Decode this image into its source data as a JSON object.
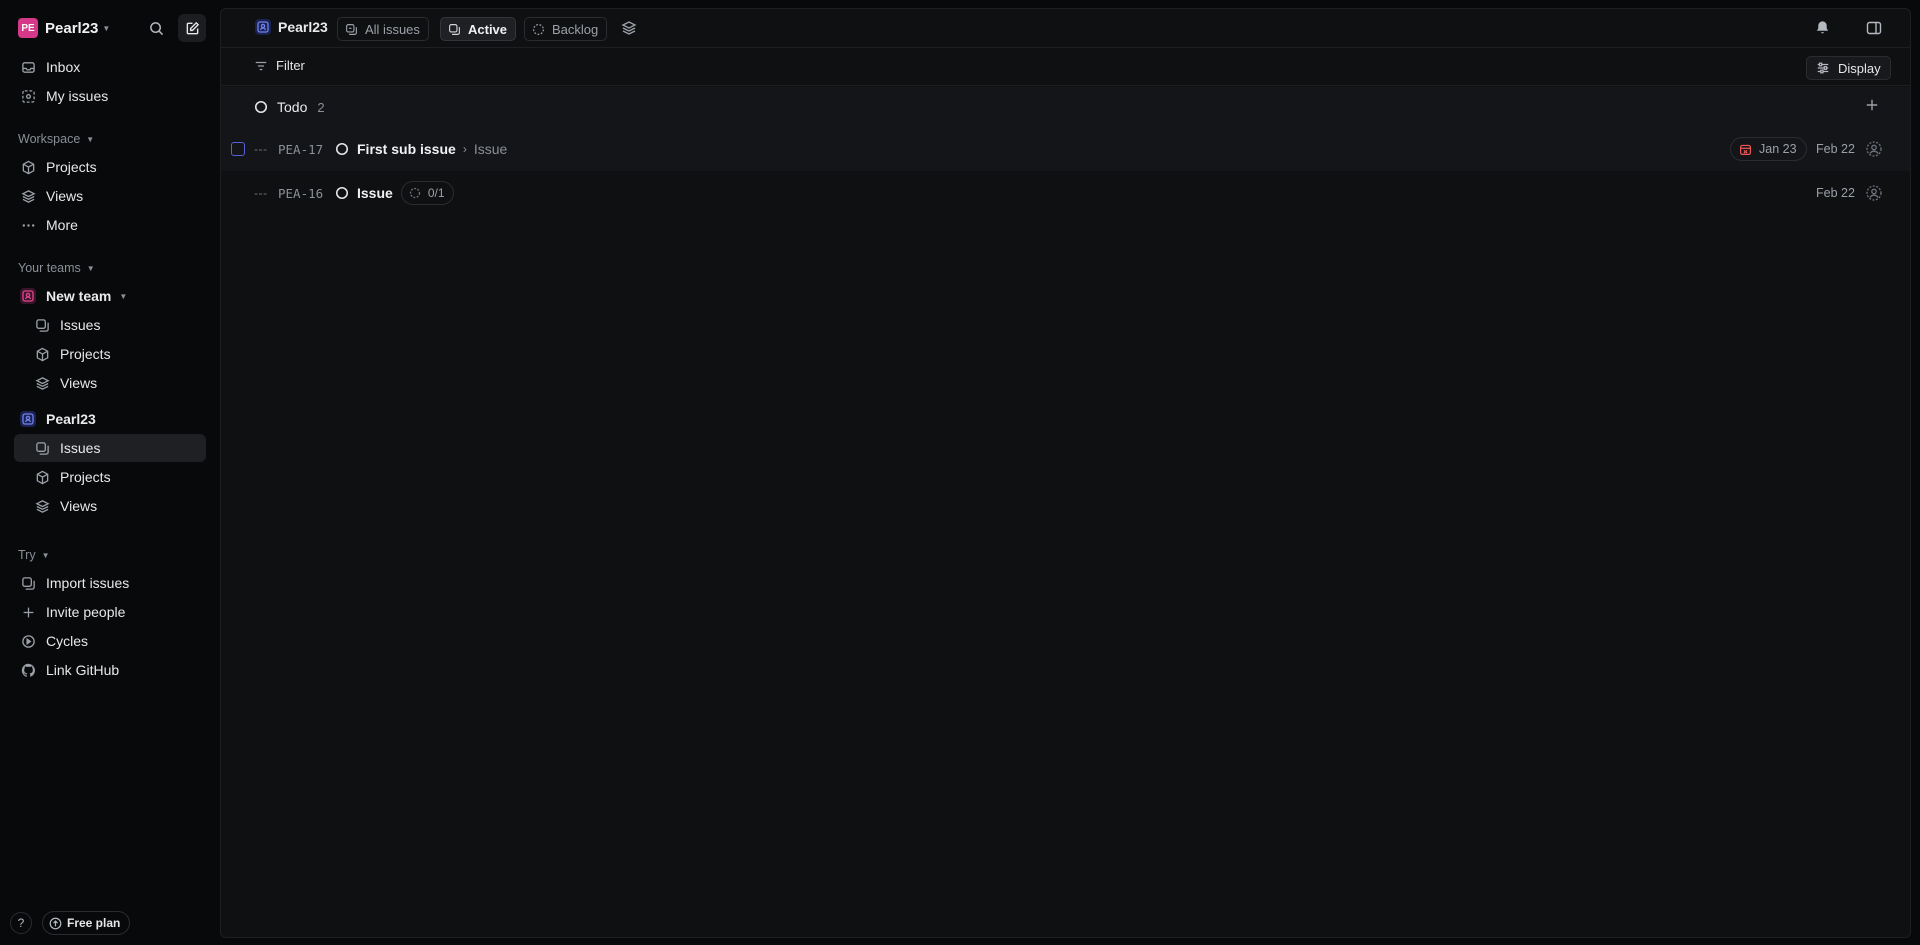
{
  "workspace": {
    "initials": "PE",
    "name": "Pearl23"
  },
  "sidebar": {
    "main": [
      {
        "label": "Inbox",
        "icon": "inbox-icon"
      },
      {
        "label": "My issues",
        "icon": "my-issues-icon"
      }
    ],
    "workspace_label": "Workspace",
    "workspace_items": [
      {
        "label": "Projects",
        "icon": "projects-icon"
      },
      {
        "label": "Views",
        "icon": "views-icon"
      },
      {
        "label": "More",
        "icon": "more-icon"
      }
    ],
    "teams_label": "Your teams",
    "teams": [
      {
        "name": "New team",
        "color": "#d6388a",
        "items": [
          {
            "label": "Issues"
          },
          {
            "label": "Projects"
          },
          {
            "label": "Views"
          }
        ]
      },
      {
        "name": "Pearl23",
        "color": "#5a6bd8",
        "items": [
          {
            "label": "Issues",
            "active": true
          },
          {
            "label": "Projects"
          },
          {
            "label": "Views"
          }
        ]
      }
    ],
    "try_label": "Try",
    "try_items": [
      {
        "label": "Import issues",
        "icon": "import-icon"
      },
      {
        "label": "Invite people",
        "icon": "plus-icon"
      },
      {
        "label": "Cycles",
        "icon": "cycles-icon"
      },
      {
        "label": "Link GitHub",
        "icon": "github-icon"
      }
    ],
    "help_label": "?",
    "plan_label": "Free plan"
  },
  "topbar": {
    "team_name": "Pearl23",
    "tabs": [
      {
        "label": "All issues",
        "active": false
      },
      {
        "label": "Active",
        "active": true
      },
      {
        "label": "Backlog",
        "active": false
      }
    ]
  },
  "filterbar": {
    "filter_label": "Filter",
    "display_label": "Display"
  },
  "group": {
    "name": "Todo",
    "count": "2"
  },
  "issues": [
    {
      "id": "PEA-17",
      "title": "First sub issue",
      "parent": "Issue",
      "due": "Jan 23",
      "created": "Feb 22",
      "due_color": "#eb5757"
    },
    {
      "id": "PEA-16",
      "title": "Issue",
      "sub_progress": "0/1",
      "created": "Feb 22"
    }
  ],
  "colors": {
    "accent": "#5a5fd6",
    "workspace_brand": "#d6388a",
    "overdue": "#eb5757"
  }
}
